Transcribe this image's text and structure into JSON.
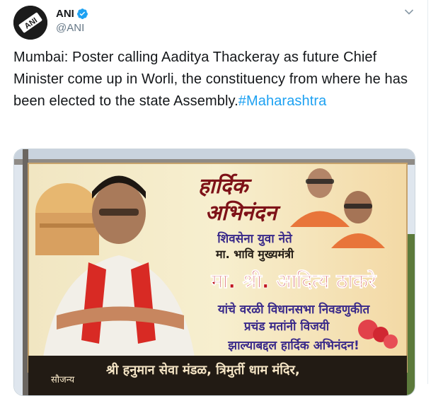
{
  "account": {
    "display_name": "ANI",
    "handle": "@ANI",
    "avatar_text": "ANI"
  },
  "tweet": {
    "text": "Mumbai: Poster calling Aaditya Thackeray as future Chief Minister come up in Worli, the constituency from where he has been elected to the state Assembly.",
    "hashtag": "#Maharashtra"
  },
  "poster": {
    "headline_1": "हार्दिक",
    "headline_2": "अभिनंदन",
    "line_1": "शिवसेना युवा नेते",
    "line_2": "मा. भावि मुख्यमंत्री",
    "line_3": "मा. श्री. आदित्य ठाकरे",
    "line_4": "यांचे वरळी विधानसभा निवडणुकीत",
    "line_5": "प्रचंड मतांनी विजयी",
    "line_6": "झाल्याबद्दल हार्दिक अभिनंदन!",
    "footer_label": "सौजन्य",
    "footer_text": "श्री हनुमान सेवा मंडळ, त्रिमुर्ती धाम मंदिर,"
  },
  "icons": {
    "verified": "verified-badge-icon",
    "caret": "chevron-down-icon"
  },
  "colors": {
    "hashtag": "#1da1f2",
    "verified": "#1da1f2",
    "handle": "#657786",
    "poster_title": "#c0141c",
    "poster_text": "#3a2a8a",
    "poster_footer": "#221b14"
  }
}
